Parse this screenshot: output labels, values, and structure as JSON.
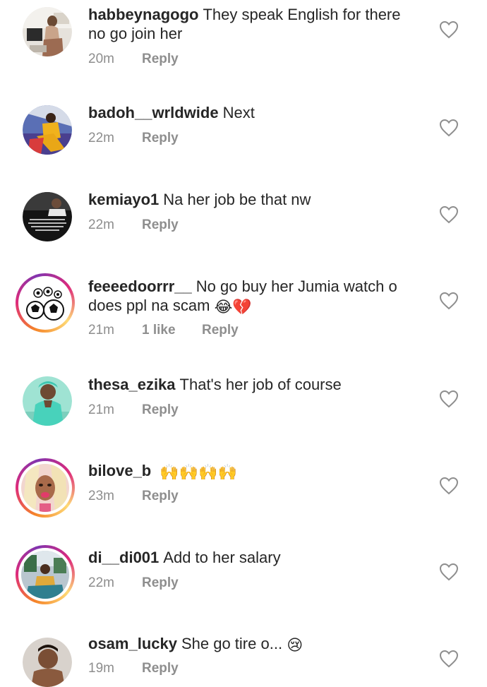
{
  "comments": [
    {
      "username": "habbeynagogo",
      "text": "They speak English for there no go join her",
      "time": "20m",
      "likes": "",
      "reply": "Reply"
    },
    {
      "username": "badoh__wrldwide",
      "text": "Next",
      "time": "22m",
      "likes": "",
      "reply": "Reply"
    },
    {
      "username": "kemiayo1",
      "text": "Na her job be that nw",
      "time": "22m",
      "likes": "",
      "reply": "Reply"
    },
    {
      "username": "feeeedoorrr__",
      "text": "No go buy her Jumia watch o does ppl na scam",
      "emoji": "😂💔",
      "time": "21m",
      "likes": "1 like",
      "reply": "Reply"
    },
    {
      "username": "thesa_ezika",
      "text": "That's her job of course",
      "time": "21m",
      "likes": "",
      "reply": "Reply"
    },
    {
      "username": "bilove_b",
      "text": "",
      "emoji": "🙌🙌🙌🙌",
      "time": "23m",
      "likes": "",
      "reply": "Reply"
    },
    {
      "username": "di__di001",
      "text": "Add to her salary",
      "time": "22m",
      "likes": "",
      "reply": "Reply"
    },
    {
      "username": "osam_lucky",
      "text": "She go tire o...",
      "emoji": "😢",
      "time": "19m",
      "likes": "",
      "reply": "Reply"
    }
  ],
  "icons": {
    "like": "heart-outline-icon"
  },
  "colors": {
    "text": "#262626",
    "meta": "#8e8e8e",
    "story_ring": "#dd2a7b"
  }
}
